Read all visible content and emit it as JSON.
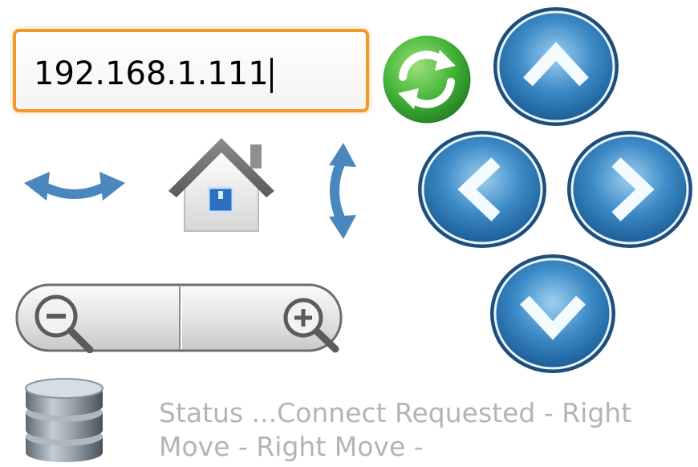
{
  "ip_field": {
    "value": "192.168.1.111"
  },
  "status": {
    "text": "Status ...Connect Requested - Right Move - Right Move -"
  },
  "colors": {
    "accent_orange": "#f09a2a",
    "nav_blue": "#2f79b3",
    "refresh_green": "#45b53a",
    "status_gray": "#b4b4b4"
  },
  "icons": [
    "refresh-icon",
    "arrow-up-icon",
    "arrow-left-icon",
    "arrow-right-icon",
    "arrow-down-icon",
    "rotate-horizontal-icon",
    "home-icon",
    "rotate-vertical-icon",
    "zoom-out-icon",
    "zoom-in-icon",
    "database-icon"
  ]
}
